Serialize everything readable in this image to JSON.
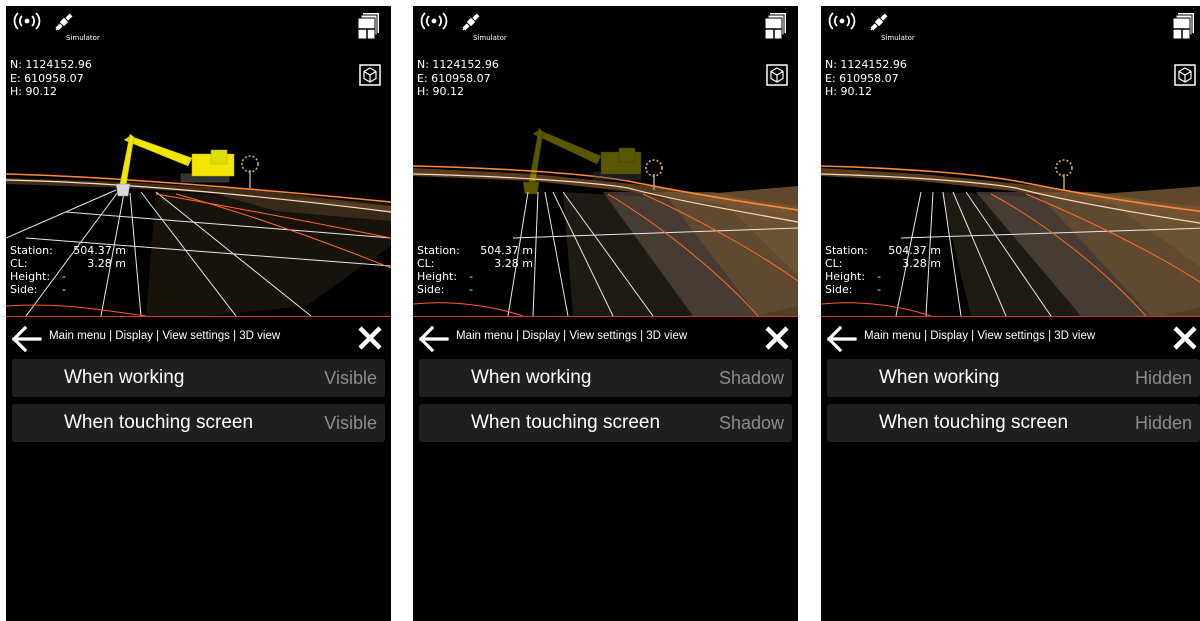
{
  "panels": [
    {
      "status": {
        "signal_icon": "wifi-signal-icon",
        "gps_icon": "satellite-icon",
        "gps_label": "Simulator"
      },
      "coords": {
        "n": "N: 1124152.96",
        "e": "E: 610958.07",
        "h": "H: 90.12"
      },
      "readout": {
        "station_label": "Station:",
        "station_value": "504.37 m",
        "cl_label": "CL:",
        "cl_value": "3.28 m",
        "height_label": "Height:",
        "height_value": "-",
        "side_label": "Side:",
        "side_value": "-"
      },
      "menu": {
        "breadcrumb": "Main menu | Display | View settings | 3D view",
        "items": [
          {
            "label": "When working",
            "value": "Visible"
          },
          {
            "label": "When touching screen",
            "value": "Visible"
          }
        ]
      },
      "machine_mode": "visible"
    },
    {
      "status": {
        "signal_icon": "wifi-signal-icon",
        "gps_icon": "satellite-icon",
        "gps_label": "Simulator"
      },
      "coords": {
        "n": "N: 1124152.96",
        "e": "E: 610958.07",
        "h": "H: 90.12"
      },
      "readout": {
        "station_label": "Station:",
        "station_value": "504.37 m",
        "cl_label": "CL:",
        "cl_value": "3.28 m",
        "height_label": "Height:",
        "height_value": "-",
        "side_label": "Side:",
        "side_value": "-"
      },
      "menu": {
        "breadcrumb": "Main menu | Display | View settings | 3D view",
        "items": [
          {
            "label": "When working",
            "value": "Shadow"
          },
          {
            "label": "When touching screen",
            "value": "Shadow"
          }
        ]
      },
      "machine_mode": "shadow"
    },
    {
      "status": {
        "signal_icon": "wifi-signal-icon",
        "gps_icon": "satellite-icon",
        "gps_label": "Simulator"
      },
      "coords": {
        "n": "N: 1124152.96",
        "e": "E: 610958.07",
        "h": "H: 90.12"
      },
      "readout": {
        "station_label": "Station:",
        "station_value": "504.37 m",
        "cl_label": "CL:",
        "cl_value": "3.28 m",
        "height_label": "Height:",
        "height_value": "-",
        "side_label": "Side:",
        "side_value": "-"
      },
      "menu": {
        "breadcrumb": "Main menu | Display | View settings | 3D view",
        "items": [
          {
            "label": "When working",
            "value": "Hidden"
          },
          {
            "label": "When touching screen",
            "value": "Hidden"
          }
        ]
      },
      "machine_mode": "hidden"
    }
  ],
  "colors": {
    "background": "#000000",
    "item_bg": "#1f1f1f",
    "value_text": "#8c8c8c",
    "accent_line": "#d23b2c",
    "excavator": "#f2e600"
  }
}
